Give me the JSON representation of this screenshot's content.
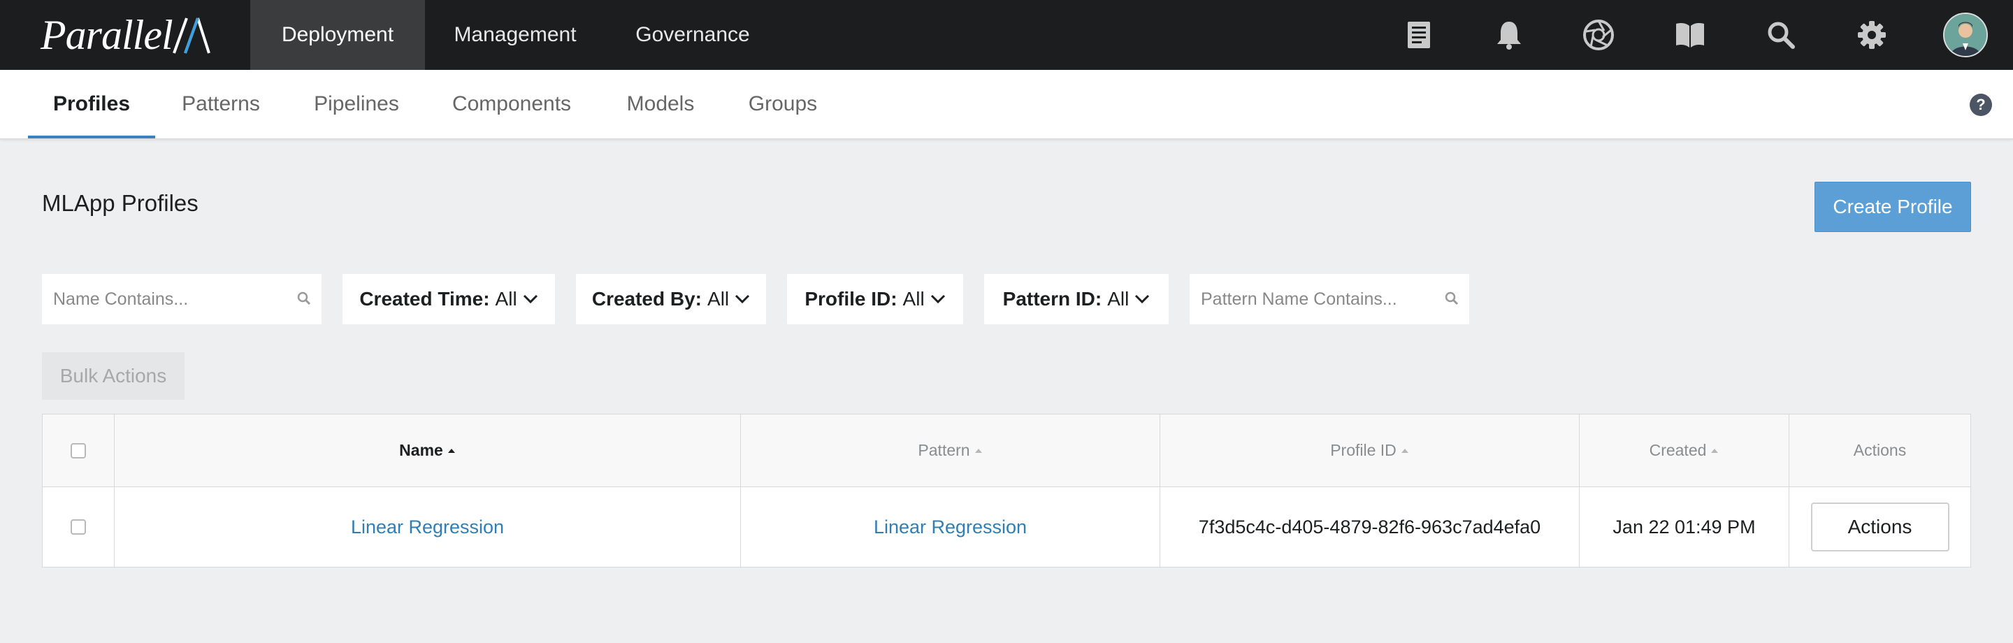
{
  "app": {
    "logo_text": "Parallel",
    "logo_mark_icon": "parallelm-mark-icon"
  },
  "topnav": {
    "tabs": [
      {
        "label": "Deployment",
        "active": true
      },
      {
        "label": "Management",
        "active": false
      },
      {
        "label": "Governance",
        "active": false
      }
    ],
    "icons": [
      "document-icon",
      "bell-icon",
      "aperture-icon",
      "book-icon",
      "search-icon",
      "gear-icon",
      "user-avatar"
    ]
  },
  "subnav": {
    "tabs": [
      {
        "label": "Profiles",
        "active": true
      },
      {
        "label": "Patterns"
      },
      {
        "label": "Pipelines"
      },
      {
        "label": "Components"
      },
      {
        "label": "Models"
      },
      {
        "label": "Groups"
      }
    ],
    "help_label": "?"
  },
  "page": {
    "title": "MLApp Profiles",
    "create_button": "Create Profile",
    "bulk_actions": "Bulk Actions"
  },
  "filters": {
    "name_placeholder": "Name Contains...",
    "created_time": {
      "key": "Created Time:",
      "value": "All"
    },
    "created_by": {
      "key": "Created By:",
      "value": "All"
    },
    "profile_id": {
      "key": "Profile ID:",
      "value": "All"
    },
    "pattern_id": {
      "key": "Pattern ID:",
      "value": "All"
    },
    "pattern_name_placeholder": "Pattern Name Contains..."
  },
  "table": {
    "columns": [
      "Name",
      "Pattern",
      "Profile ID",
      "Created",
      "Actions"
    ],
    "rows": [
      {
        "name": "Linear Regression",
        "pattern": "Linear Regression",
        "profile_id": "7f3d5c4c-d405-4879-82f6-963c7ad4efa0",
        "created": "Jan 22 01:49 PM",
        "actions": "Actions"
      }
    ]
  },
  "colors": {
    "topbar": "#1b1d1f",
    "accent": "#3b82c4",
    "link": "#2f7fb5",
    "create_button": "#5b9fd6"
  }
}
